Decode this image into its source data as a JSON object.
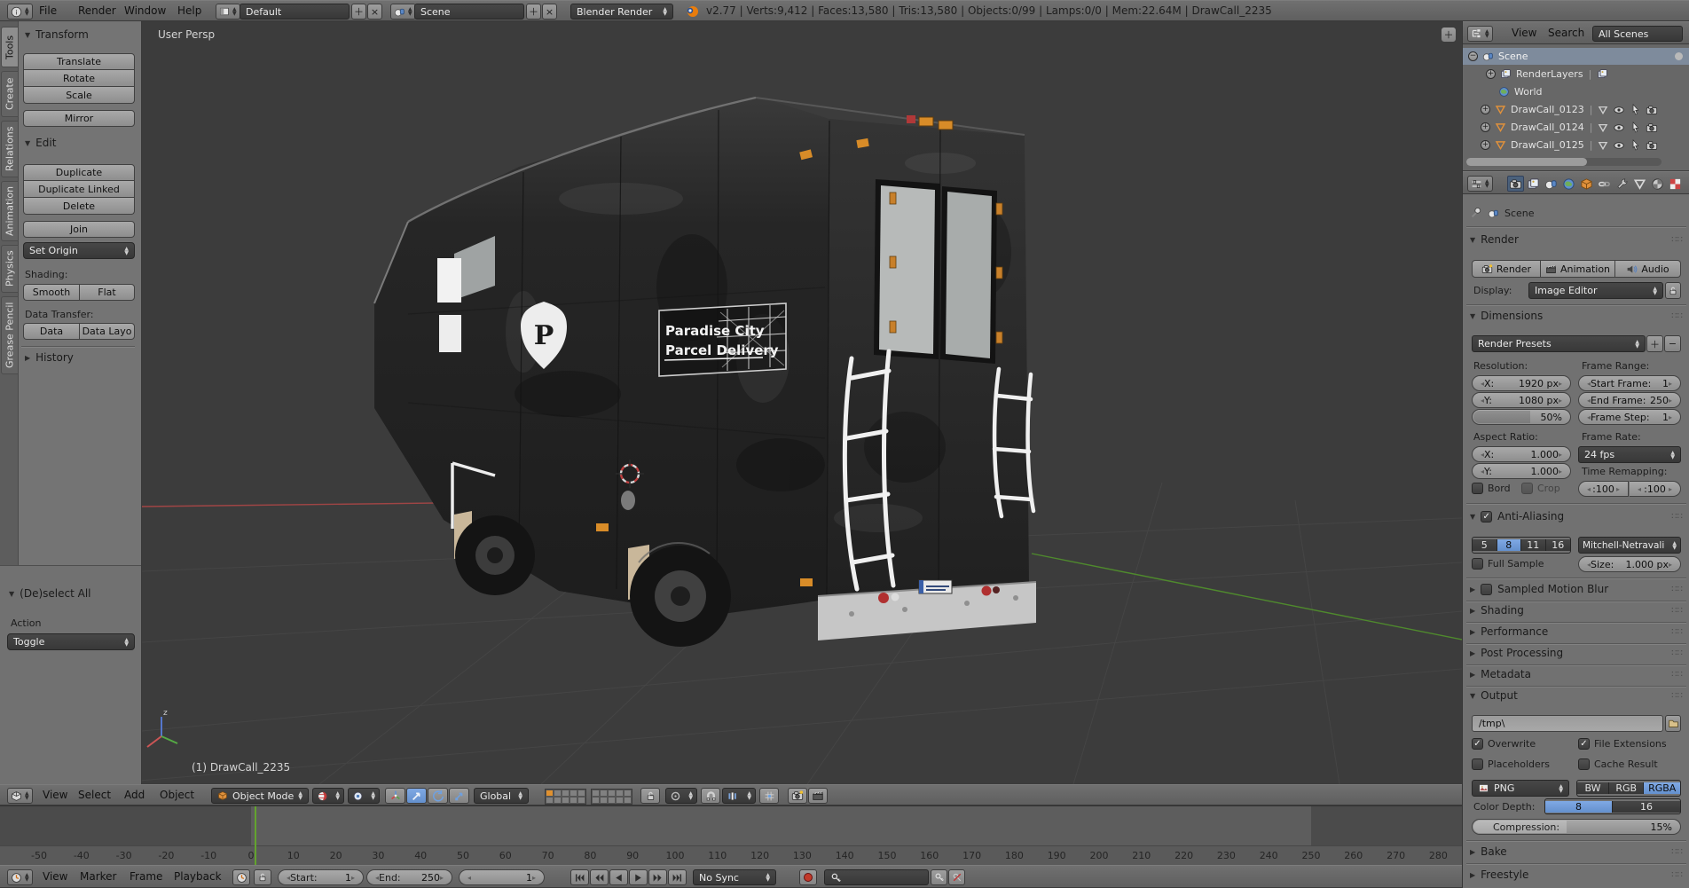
{
  "topbar": {
    "menus": [
      "File",
      "Render",
      "Window",
      "Help"
    ],
    "layout_value": "Default",
    "scene_value": "Scene",
    "engine_value": "Blender Render",
    "stats": "v2.77 | Verts:9,412 | Faces:13,580 | Tris:13,580 | Objects:0/99 | Lamps:0/0 | Mem:22.64M | DrawCall_2235"
  },
  "toolshelf": {
    "tabs": [
      "Tools",
      "Create",
      "Relations",
      "Animation",
      "Physics",
      "Grease Pencil"
    ],
    "transform_title": "Transform",
    "translate": "Translate",
    "rotate": "Rotate",
    "scale": "Scale",
    "mirror": "Mirror",
    "edit_title": "Edit",
    "duplicate": "Duplicate",
    "duplicate_linked": "Duplicate Linked",
    "delete": "Delete",
    "join": "Join",
    "set_origin": "Set Origin",
    "shading_label": "Shading:",
    "smooth": "Smooth",
    "flat": "Flat",
    "data_transfer_label": "Data Transfer:",
    "data": "Data",
    "data_layo": "Data Layo",
    "history_title": "History",
    "operator_title": "(De)select All",
    "action_label": "Action",
    "action_value": "Toggle"
  },
  "viewport": {
    "view_label": "User Persp",
    "active_object": "(1) DrawCall_2235",
    "decal_line1": "Paradise City",
    "decal_line2": "Parcel Delivery"
  },
  "view3d_header": {
    "menus": [
      "View",
      "Select",
      "Add",
      "Object"
    ],
    "mode_value": "Object Mode",
    "orientation_value": "Global"
  },
  "timeline": {
    "menus": [
      "View",
      "Marker",
      "Frame",
      "Playback"
    ],
    "start_label": "Start:",
    "start_value": "1",
    "end_label": "End:",
    "end_value": "250",
    "current_frame": "1",
    "sync_value": "No Sync",
    "ticks": [
      -50,
      -40,
      -30,
      -20,
      -10,
      0,
      10,
      20,
      30,
      40,
      50,
      60,
      70,
      80,
      90,
      100,
      110,
      120,
      130,
      140,
      150,
      160,
      170,
      180,
      190,
      200,
      210,
      220,
      230,
      240,
      250,
      260,
      270,
      280
    ]
  },
  "outliner": {
    "menus": [
      "View",
      "Search"
    ],
    "scenes_filter": "All Scenes",
    "rows": [
      {
        "label": "Scene"
      },
      {
        "label": "RenderLayers"
      },
      {
        "label": "World"
      },
      {
        "label": "DrawCall_0123"
      },
      {
        "label": "DrawCall_0124"
      },
      {
        "label": "DrawCall_0125"
      }
    ]
  },
  "properties": {
    "context_label": "Scene",
    "render_title": "Render",
    "render_button": "Render",
    "animation_button": "Animation",
    "audio_button": "Audio",
    "display_label": "Display:",
    "display_value": "Image Editor",
    "dimensions_title": "Dimensions",
    "presets_value": "Render Presets",
    "resolution_label": "Resolution:",
    "res_x_label": "X:",
    "res_x_value": "1920 px",
    "res_y_label": "Y:",
    "res_y_value": "1080 px",
    "res_pct": "50%",
    "frame_range_label": "Frame Range:",
    "start_frame_label": "Start Frame:",
    "start_frame_value": "1",
    "end_frame_label": "End Frame:",
    "end_frame_value": "250",
    "frame_step_label": "Frame Step:",
    "frame_step_value": "1",
    "aspect_label": "Aspect Ratio:",
    "aspect_x_label": "X:",
    "aspect_x_value": "1.000",
    "aspect_y_label": "Y:",
    "aspect_y_value": "1.000",
    "frame_rate_label": "Frame Rate:",
    "frame_rate_value": "24 fps",
    "time_remap_label": "Time Remapping:",
    "border_label": "Bord",
    "crop_label": "Crop",
    "remap_old": ":100",
    "remap_new": ":100",
    "aa_title": "Anti-Aliasing",
    "aa_samples": [
      "5",
      "8",
      "11",
      "16"
    ],
    "aa_filter_value": "Mitchell-Netravali",
    "full_sample_label": "Full Sample",
    "aa_size_label": "Size:",
    "aa_size_value": "1.000 px",
    "motion_blur_title": "Sampled Motion Blur",
    "shading_title": "Shading",
    "performance_title": "Performance",
    "post_processing_title": "Post Processing",
    "metadata_title": "Metadata",
    "output_title": "Output",
    "output_path": "/tmp\\",
    "overwrite_label": "Overwrite",
    "file_ext_label": "File Extensions",
    "placeholders_label": "Placeholders",
    "cache_label": "Cache Result",
    "format_value": "PNG",
    "bw_label": "BW",
    "rgb_label": "RGB",
    "rgba_label": "RGBA",
    "color_depth_label": "Color Depth:",
    "depth_8": "8",
    "depth_16": "16",
    "compression_label": "Compression:",
    "compression_value": "15%",
    "bake_title": "Bake",
    "freestyle_title": "Freestyle"
  }
}
